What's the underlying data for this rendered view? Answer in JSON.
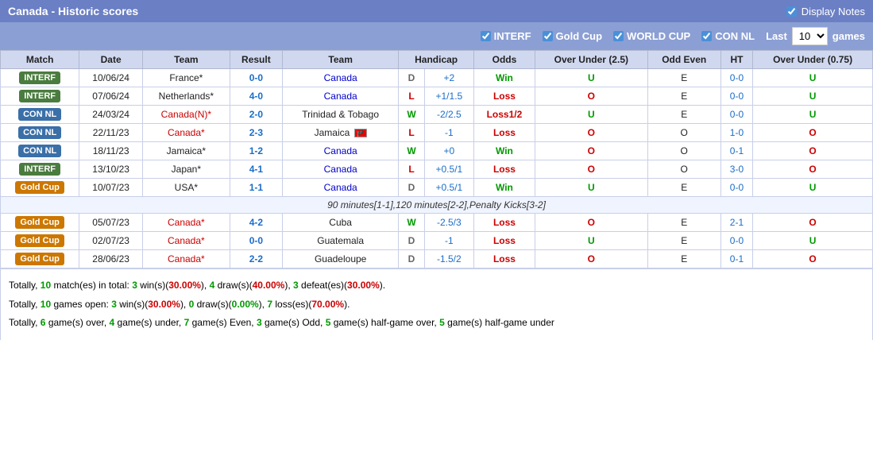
{
  "header": {
    "title": "Canada - Historic scores",
    "display_notes_label": "Display Notes"
  },
  "filters": {
    "interf": {
      "label": "INTERF",
      "checked": true
    },
    "gold_cup": {
      "label": "Gold Cup",
      "checked": true
    },
    "world_cup": {
      "label": "WORLD CUP",
      "checked": true
    },
    "con_nl": {
      "label": "CON NL",
      "checked": true
    },
    "last_label": "Last",
    "games_label": "games",
    "last_value": "10"
  },
  "columns": {
    "match": "Match",
    "date": "Date",
    "team_home": "Team",
    "result": "Result",
    "team_away": "Team",
    "handicap": "Handicap",
    "odds": "Odds",
    "over_under_25": "Over Under (2.5)",
    "odd_even": "Odd Even",
    "ht": "HT",
    "over_under_075": "Over Under (0.75)"
  },
  "rows": [
    {
      "badge": "INTERF",
      "badge_type": "interf",
      "date": "10/06/24",
      "team1": "France*",
      "team1_class": "team-neutral",
      "result": "0-0",
      "team2": "Canada",
      "team2_class": "team-away",
      "outcome": "D",
      "handicap": "+2",
      "odds": "Win",
      "over_under": "U",
      "odd_even": "E",
      "ht": "0-0",
      "ou075": "U"
    },
    {
      "badge": "INTERF",
      "badge_type": "interf",
      "date": "07/06/24",
      "team1": "Netherlands*",
      "team1_class": "team-neutral",
      "result": "4-0",
      "team2": "Canada",
      "team2_class": "team-away",
      "outcome": "L",
      "handicap": "+1/1.5",
      "odds": "Loss",
      "over_under": "O",
      "odd_even": "E",
      "ht": "0-0",
      "ou075": "U"
    },
    {
      "badge": "CON NL",
      "badge_type": "con-nl",
      "date": "24/03/24",
      "team1": "Canada(N)*",
      "team1_class": "team-home",
      "result": "2-0",
      "team2": "Trinidad & Tobago",
      "team2_class": "team-neutral",
      "outcome": "W",
      "handicap": "-2/2.5",
      "odds": "Loss1/2",
      "over_under": "U",
      "odd_even": "E",
      "ht": "0-0",
      "ou075": "U"
    },
    {
      "badge": "CON NL",
      "badge_type": "con-nl",
      "date": "22/11/23",
      "team1": "Canada*",
      "team1_class": "team-home",
      "result": "2-3",
      "team2": "Jamaica",
      "team2_class": "team-neutral",
      "outcome": "L",
      "handicap": "-1",
      "odds": "Loss",
      "over_under": "O",
      "odd_even": "O",
      "ht": "1-0",
      "ou075": "O",
      "team2_flag": true
    },
    {
      "badge": "CON NL",
      "badge_type": "con-nl",
      "date": "18/11/23",
      "team1": "Jamaica*",
      "team1_class": "team-neutral",
      "result": "1-2",
      "team2": "Canada",
      "team2_class": "team-away",
      "outcome": "W",
      "handicap": "+0",
      "odds": "Win",
      "over_under": "O",
      "odd_even": "O",
      "ht": "0-1",
      "ou075": "O"
    },
    {
      "badge": "INTERF",
      "badge_type": "interf",
      "date": "13/10/23",
      "team1": "Japan*",
      "team1_class": "team-neutral",
      "result": "4-1",
      "team2": "Canada",
      "team2_class": "team-away",
      "outcome": "L",
      "handicap": "+0.5/1",
      "odds": "Loss",
      "over_under": "O",
      "odd_even": "O",
      "ht": "3-0",
      "ou075": "O"
    },
    {
      "badge": "Gold Cup",
      "badge_type": "gold-cup",
      "date": "10/07/23",
      "team1": "USA*",
      "team1_class": "team-neutral",
      "result": "1-1",
      "team2": "Canada",
      "team2_class": "team-away",
      "outcome": "D",
      "handicap": "+0.5/1",
      "odds": "Win",
      "over_under": "U",
      "odd_even": "E",
      "ht": "0-0",
      "ou075": "U"
    },
    {
      "note": "90 minutes[1-1],120 minutes[2-2],Penalty Kicks[3-2]",
      "is_note": true
    },
    {
      "badge": "Gold Cup",
      "badge_type": "gold-cup",
      "date": "05/07/23",
      "team1": "Canada*",
      "team1_class": "team-home",
      "result": "4-2",
      "team2": "Cuba",
      "team2_class": "team-neutral",
      "outcome": "W",
      "handicap": "-2.5/3",
      "odds": "Loss",
      "over_under": "O",
      "odd_even": "E",
      "ht": "2-1",
      "ou075": "O"
    },
    {
      "badge": "Gold Cup",
      "badge_type": "gold-cup",
      "date": "02/07/23",
      "team1": "Canada*",
      "team1_class": "team-home",
      "result": "0-0",
      "team2": "Guatemala",
      "team2_class": "team-neutral",
      "outcome": "D",
      "handicap": "-1",
      "odds": "Loss",
      "over_under": "U",
      "odd_even": "E",
      "ht": "0-0",
      "ou075": "U"
    },
    {
      "badge": "Gold Cup",
      "badge_type": "gold-cup",
      "date": "28/06/23",
      "team1": "Canada*",
      "team1_class": "team-home",
      "result": "2-2",
      "team2": "Guadeloupe",
      "team2_class": "team-neutral",
      "outcome": "D",
      "handicap": "-1.5/2",
      "odds": "Loss",
      "over_under": "O",
      "odd_even": "E",
      "ht": "0-1",
      "ou075": "O"
    }
  ],
  "summary": {
    "line1_prefix": "Totally, ",
    "line1_total": "10",
    "line1_mid": " match(es) in total: ",
    "line1_wins": "3",
    "line1_wins_pct": "30.00%",
    "line1_draws": "4",
    "line1_draws_pct": "40.00%",
    "line1_defeats": "3",
    "line1_defeats_pct": "30.00%",
    "line2_prefix": "Totally, ",
    "line2_total": "10",
    "line2_mid": " games open: ",
    "line2_wins": "3",
    "line2_wins_pct": "30.00%",
    "line2_draws": "0",
    "line2_draws_pct": "0.00%",
    "line2_losses": "7",
    "line2_losses_pct": "70.00%",
    "line3": "Totally, 6 game(s) over, 4 game(s) under, 7 game(s) Even, 3 game(s) Odd, 5 game(s) half-game over, 5 game(s) half-game under"
  }
}
